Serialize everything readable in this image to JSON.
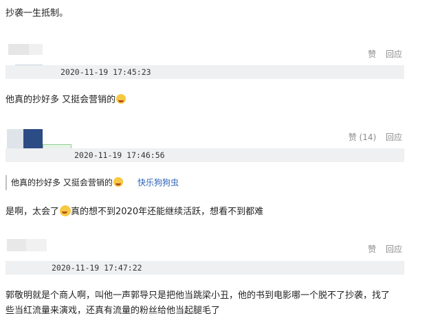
{
  "comments": [
    {
      "text": "抄袭一生抵制。"
    },
    {
      "timestamp": "2020-11-19 17:45:23",
      "like_label": "赞",
      "reply_label": "回应",
      "text": "他真的抄好多 又挺会营销的"
    },
    {
      "timestamp": "2020-11-19 17:46:56",
      "like_label": "赞 (14)",
      "reply_label": "回应",
      "quote_text": "他真的抄好多 又挺会营销的",
      "quote_user": "快乐狗狗虫",
      "text_before_emoji": "是啊，太会了",
      "text_after_emoji": "真的想不到2020年还能继续活跃，想看不到都难"
    },
    {
      "timestamp": "2020-11-19 17:47:22",
      "like_label": "赞",
      "reply_label": "回应",
      "line1": "郭敬明就是个商人啊，叫他一声郭导只是把他当跳梁小丑，他的书到电影哪一个脱不了抄袭，找了",
      "line2": "些当红流量来演戏，还真有流量的粉丝给他当起腿毛了"
    }
  ],
  "icons": [
    "star-struck-emoji-icon",
    "laughing-tears-emoji-icon"
  ],
  "colors": {
    "meta_bar": "#eef0f2",
    "link": "#2b62b8",
    "muted": "#8a8a8a"
  }
}
